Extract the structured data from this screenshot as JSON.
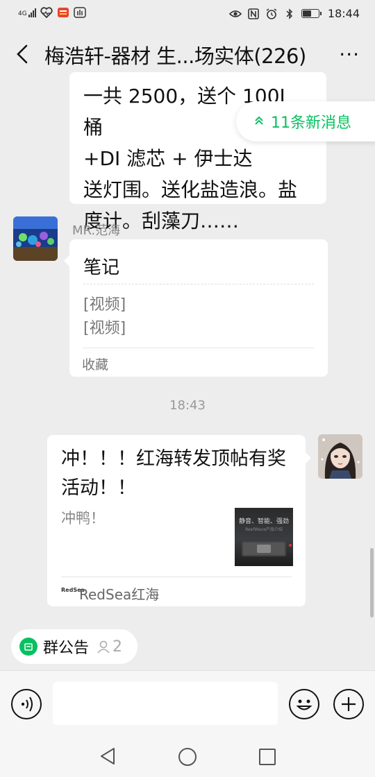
{
  "status_bar": {
    "network": "4G",
    "time": "18:44",
    "battery_level": 0.55,
    "icons": [
      "signal-icon",
      "heart-app-icon",
      "app-notification-icon",
      "hand-app-icon",
      "eye-icon",
      "nfc-icon",
      "alarm-icon",
      "bluetooth-icon",
      "battery-icon"
    ]
  },
  "header": {
    "title": "梅浩轩-器材 生...场实体(226)",
    "back_icon": "chevron-left-icon",
    "more_icon": "more-dots-icon",
    "more_label": "···"
  },
  "new_messages": {
    "label": "11条新消息",
    "icon": "double-chevron-up-icon",
    "color": "#07c160"
  },
  "messages": [
    {
      "type": "text",
      "lines": [
        "一共 2500，送个 100L 桶",
        "+DI 滤芯 + 伊士达",
        "送灯围。送化盐造浪。盐",
        "度计。刮藻刀……"
      ]
    },
    {
      "type": "note",
      "sender": "MR.范海",
      "title": "笔记",
      "lines": [
        "[视频]",
        "[视频]"
      ],
      "footer": "收藏"
    },
    {
      "type": "timestamp",
      "text": "18:43"
    },
    {
      "type": "link",
      "title": "冲！！！红海转发顶帖有奖活动！！",
      "description": "冲鸭！",
      "thumb_text": "静音、智能、强劲",
      "thumb_subtext": "ReefWave产品介绍",
      "source_logo": "RedSea",
      "source": "RedSea红海"
    }
  ],
  "group_notice": {
    "label": "群公告",
    "count": "2",
    "icon": "notice-icon",
    "count_icon": "person-icon"
  },
  "input_bar": {
    "voice_icon": "voice-icon",
    "emoji_icon": "emoji-icon",
    "plus_icon": "plus-icon",
    "placeholder": ""
  },
  "nav_bar": {
    "icons": [
      "nav-back-icon",
      "nav-home-icon",
      "nav-recent-icon"
    ]
  },
  "colors": {
    "background": "#ededed",
    "accent": "#07c160",
    "bubble": "#ffffff"
  }
}
